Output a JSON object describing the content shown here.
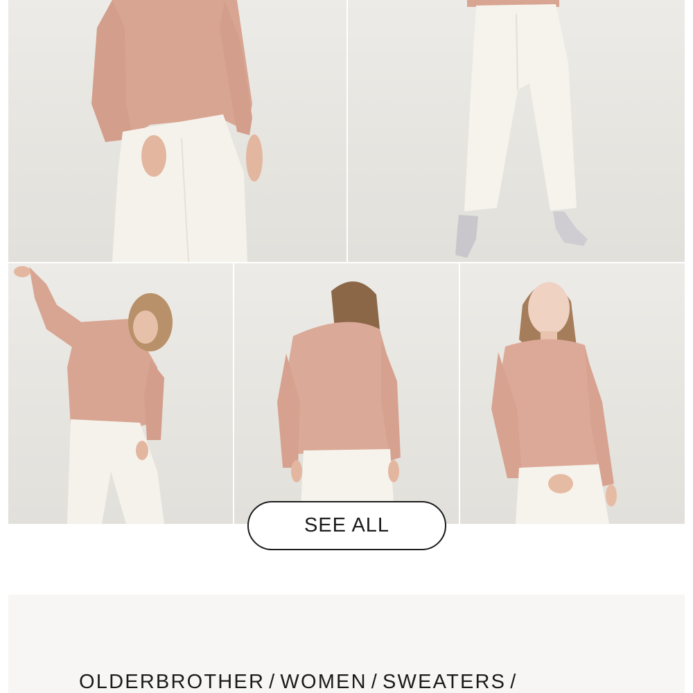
{
  "gallery": {
    "photos": [
      {
        "alt": "Model wearing pink fuzzy sweater and white pants, close crop"
      },
      {
        "alt": "White pants with grey pumps, full length"
      },
      {
        "alt": "Model with arm raised wearing pink sweater"
      },
      {
        "alt": "Back view of pink sweater"
      },
      {
        "alt": "Front view of model in pink sweater"
      }
    ]
  },
  "cta": {
    "see_all_label": "SEE ALL"
  },
  "breadcrumb": {
    "items": [
      "OLDERBROTHER",
      "WOMEN",
      "SWEATERS"
    ],
    "separator": "/"
  },
  "colors": {
    "sweater": "#d9a896",
    "pants": "#f4f1ea",
    "background": "#e8e6e1",
    "button_border": "#1a1a1a"
  }
}
